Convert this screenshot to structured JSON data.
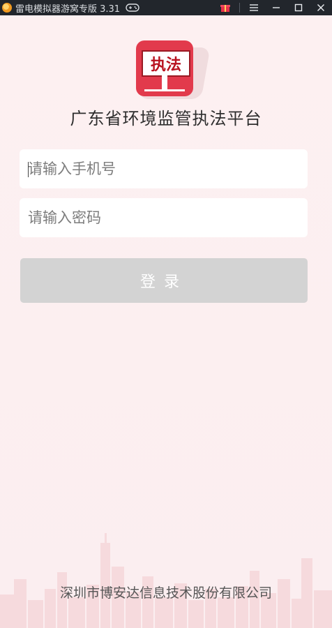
{
  "window": {
    "title": "雷电模拟器游窝专版 3.31",
    "icons": [
      "leidian-logo-icon",
      "gamepad-icon",
      "gift-icon",
      "menu-icon",
      "minimize-icon",
      "maximize-icon",
      "close-icon"
    ]
  },
  "app": {
    "logo_text": "执法",
    "title": "广东省环境监管执法平台",
    "phone_placeholder": "请输入手机号",
    "password_placeholder": "请输入密码",
    "login_label": "登录",
    "company": "深圳市博安达信息技术股份有限公司"
  },
  "colors": {
    "logo_red": "#e23a4c",
    "button_disabled": "#d3d3d3",
    "background": "#fdf1f2"
  }
}
